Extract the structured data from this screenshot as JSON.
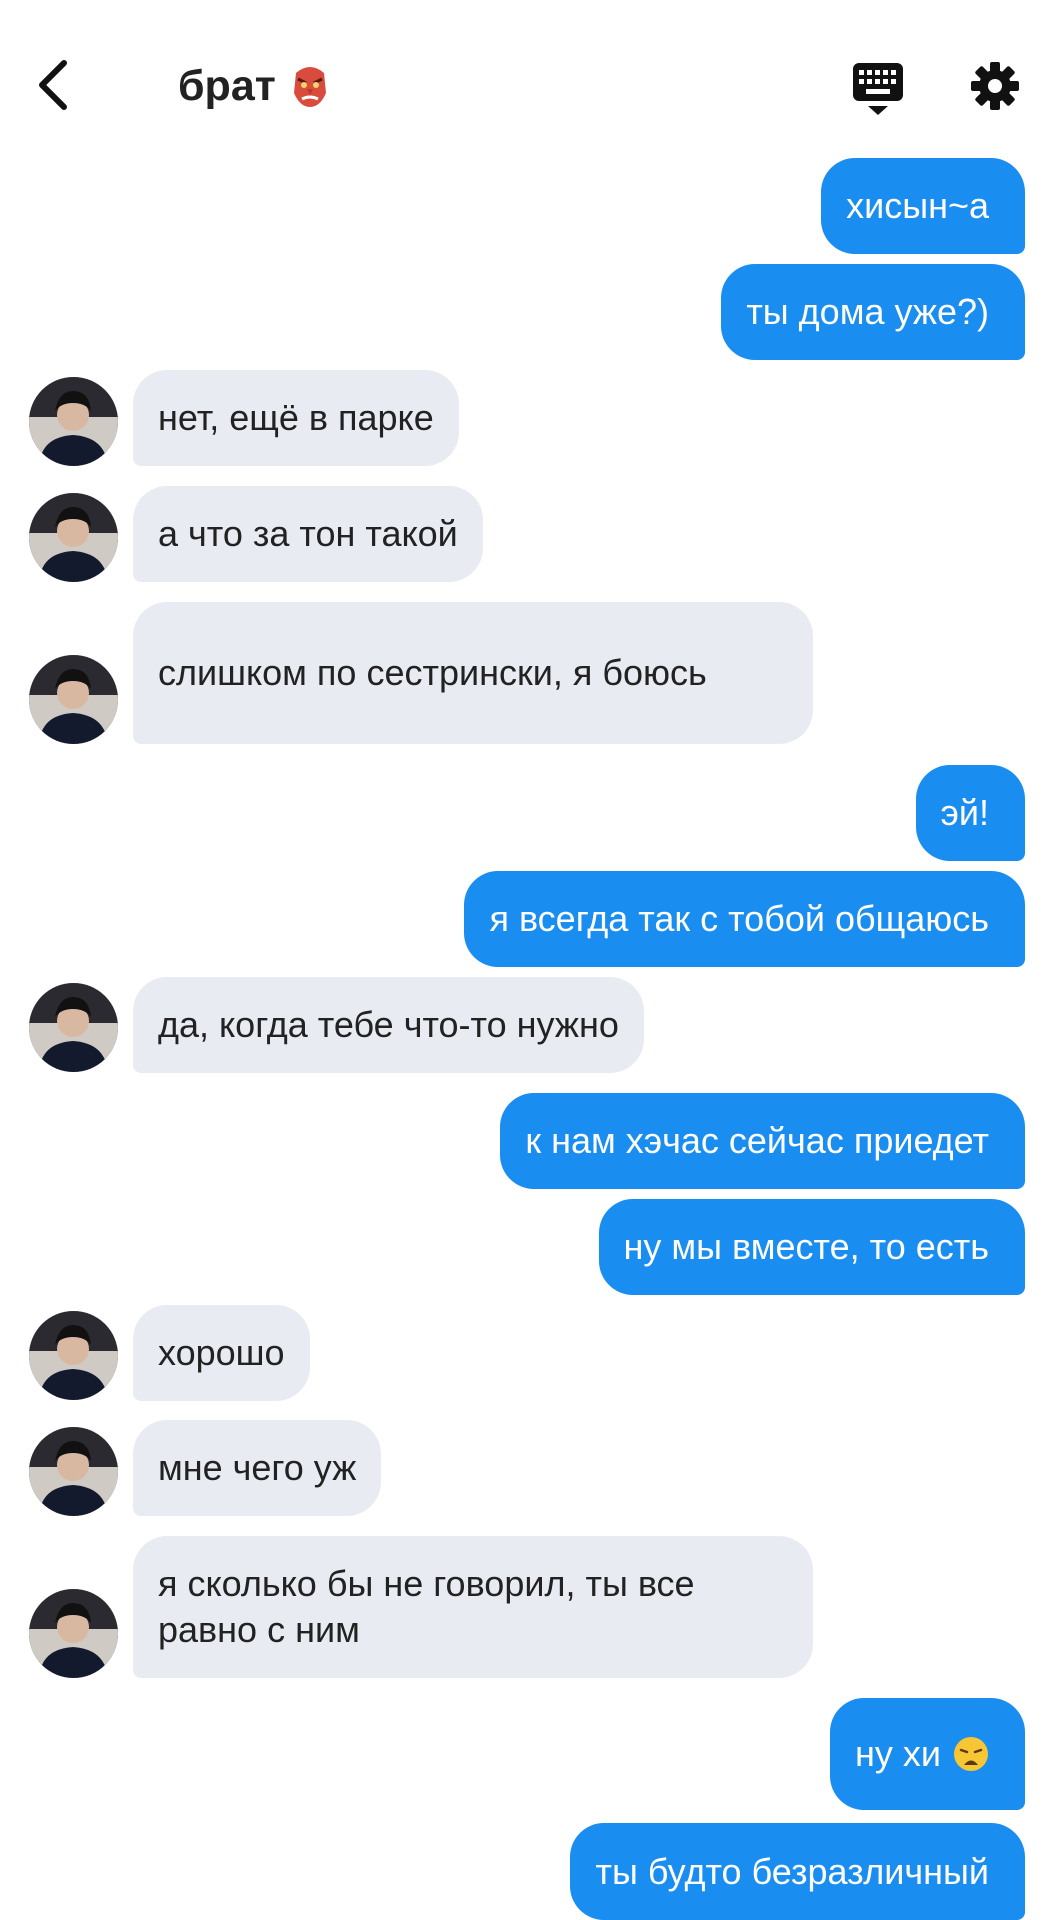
{
  "header": {
    "title": "брат",
    "title_emoji": "goblin-mask-icon"
  },
  "colors": {
    "outgoing_bubble": "#1a8df0",
    "incoming_bubble": "#e8ebf2",
    "accent": "#1a8df0"
  },
  "messages": [
    {
      "direction": "out",
      "text": "хисын~а"
    },
    {
      "direction": "out",
      "text": "ты дома уже?)"
    },
    {
      "direction": "in",
      "text": "нет, ещё в парке"
    },
    {
      "direction": "in",
      "text": "а что за тон такой"
    },
    {
      "direction": "in",
      "text": "слишком по сестрински, я боюсь"
    },
    {
      "direction": "out",
      "text": "эй!"
    },
    {
      "direction": "out",
      "text": "я всегда так с тобой общаюсь"
    },
    {
      "direction": "in",
      "text": "да, когда тебе что-то нужно"
    },
    {
      "direction": "out",
      "text": "к нам хэчас сейчас приедет"
    },
    {
      "direction": "out",
      "text": "ну мы вместе, то есть"
    },
    {
      "direction": "in",
      "text": "хорошо"
    },
    {
      "direction": "in",
      "text": "мне чего уж"
    },
    {
      "direction": "in",
      "text": "я сколько бы не говорил, ты все равно с ним"
    },
    {
      "direction": "out",
      "text": "ну хи",
      "emoji": "weary-face-icon"
    },
    {
      "direction": "out",
      "text": "ты будто безразличный"
    }
  ]
}
